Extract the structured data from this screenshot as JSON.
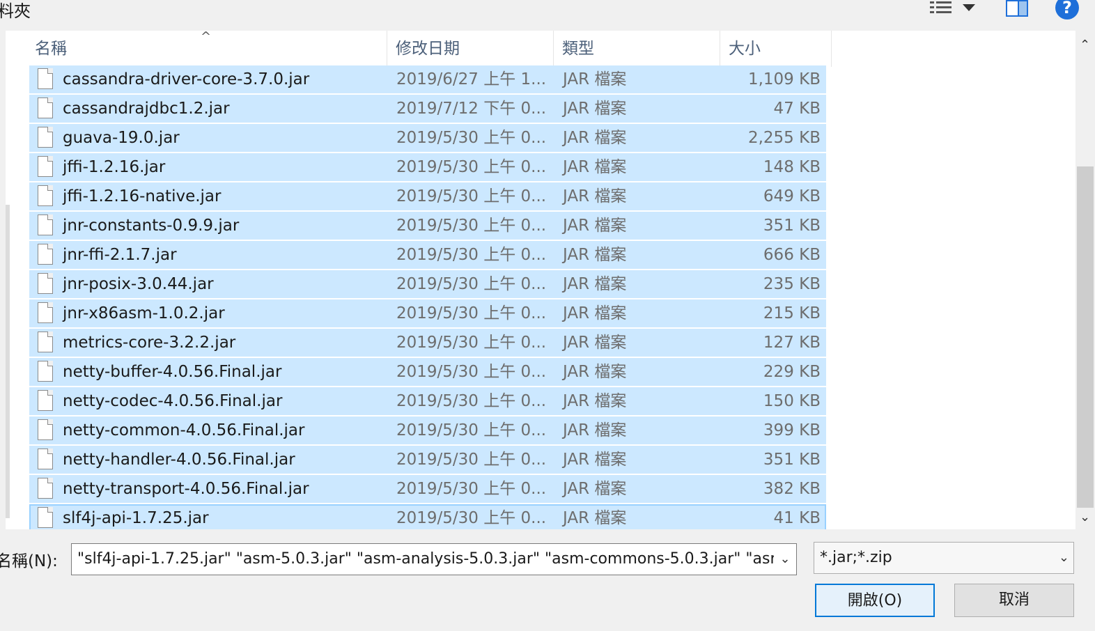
{
  "toolbar": {
    "title_fragment": "料夾",
    "view_icon": "details-view-icon",
    "pane_icon": "preview-pane-icon",
    "help_icon": "help-icon",
    "help_glyph": "?"
  },
  "columns": {
    "name": "名稱",
    "modified": "修改日期",
    "type": "類型",
    "size": "大小"
  },
  "files": [
    {
      "name": "cassandra-driver-core-3.7.0.jar",
      "date": "2019/6/27 上午 1...",
      "type": "JAR 檔案",
      "size": "1,109 KB"
    },
    {
      "name": "cassandrajdbc1.2.jar",
      "date": "2019/7/12 下午 0...",
      "type": "JAR 檔案",
      "size": "47 KB"
    },
    {
      "name": "guava-19.0.jar",
      "date": "2019/5/30 上午 0...",
      "type": "JAR 檔案",
      "size": "2,255 KB"
    },
    {
      "name": "jffi-1.2.16.jar",
      "date": "2019/5/30 上午 0...",
      "type": "JAR 檔案",
      "size": "148 KB"
    },
    {
      "name": "jffi-1.2.16-native.jar",
      "date": "2019/5/30 上午 0...",
      "type": "JAR 檔案",
      "size": "649 KB"
    },
    {
      "name": "jnr-constants-0.9.9.jar",
      "date": "2019/5/30 上午 0...",
      "type": "JAR 檔案",
      "size": "351 KB"
    },
    {
      "name": "jnr-ffi-2.1.7.jar",
      "date": "2019/5/30 上午 0...",
      "type": "JAR 檔案",
      "size": "666 KB"
    },
    {
      "name": "jnr-posix-3.0.44.jar",
      "date": "2019/5/30 上午 0...",
      "type": "JAR 檔案",
      "size": "235 KB"
    },
    {
      "name": "jnr-x86asm-1.0.2.jar",
      "date": "2019/5/30 上午 0...",
      "type": "JAR 檔案",
      "size": "215 KB"
    },
    {
      "name": "metrics-core-3.2.2.jar",
      "date": "2019/5/30 上午 0...",
      "type": "JAR 檔案",
      "size": "127 KB"
    },
    {
      "name": "netty-buffer-4.0.56.Final.jar",
      "date": "2019/5/30 上午 0...",
      "type": "JAR 檔案",
      "size": "229 KB"
    },
    {
      "name": "netty-codec-4.0.56.Final.jar",
      "date": "2019/5/30 上午 0...",
      "type": "JAR 檔案",
      "size": "150 KB"
    },
    {
      "name": "netty-common-4.0.56.Final.jar",
      "date": "2019/5/30 上午 0...",
      "type": "JAR 檔案",
      "size": "399 KB"
    },
    {
      "name": "netty-handler-4.0.56.Final.jar",
      "date": "2019/5/30 上午 0...",
      "type": "JAR 檔案",
      "size": "351 KB"
    },
    {
      "name": "netty-transport-4.0.56.Final.jar",
      "date": "2019/5/30 上午 0...",
      "type": "JAR 檔案",
      "size": "382 KB"
    },
    {
      "name": "slf4j-api-1.7.25.jar",
      "date": "2019/5/30 上午 0...",
      "type": "JAR 檔案",
      "size": "41 KB"
    }
  ],
  "bottom": {
    "filename_label": "名稱(N):",
    "filename_value": "\"slf4j-api-1.7.25.jar\" \"asm-5.0.3.jar\" \"asm-analysis-5.0.3.jar\" \"asm-commons-5.0.3.jar\" \"asr",
    "filter_value": "*.jar;*.zip",
    "open_label": "開啟(O)",
    "cancel_label": "取消"
  },
  "colors": {
    "selection": "#cce8ff",
    "focus_border": "#99d1ff",
    "accent": "#0078d7"
  }
}
